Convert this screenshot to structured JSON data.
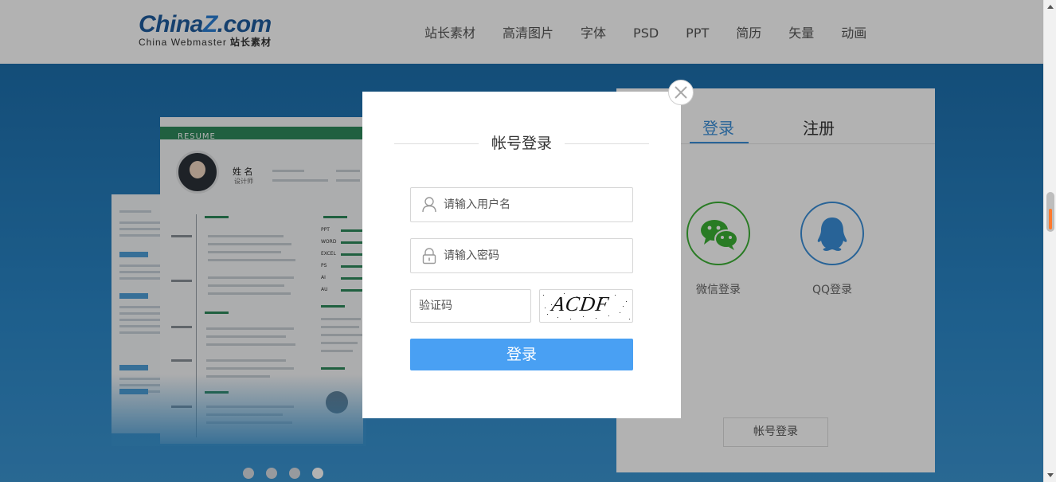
{
  "header": {
    "logo": {
      "main_left": "China",
      "main_z": "Z",
      "main_right": ".com",
      "sub_en": "China Webmaster",
      "sub_cn": "站长素材"
    },
    "nav": [
      "站长素材",
      "高清图片",
      "字体",
      "PSD",
      "PPT",
      "简历",
      "矢量",
      "动画"
    ]
  },
  "hero": {
    "resume": {
      "banner": "RESUME",
      "name": "姓 名",
      "title": "设计师"
    },
    "carousel": {
      "dot_count": 4,
      "active_index": 3
    }
  },
  "login_panel": {
    "tabs": {
      "login": "登录",
      "register": "注册"
    },
    "social": {
      "wechat_label": "微信登录",
      "qq_label": "QQ登录"
    },
    "account_login_button": "帐号登录"
  },
  "modal": {
    "title": "帐号登录",
    "username": {
      "placeholder": "请输入用户名",
      "value": ""
    },
    "password": {
      "placeholder": "请输入密码",
      "value": ""
    },
    "captcha": {
      "placeholder": "验证码",
      "value": "",
      "image_text": "ACDF"
    },
    "submit_label": "登录"
  },
  "colors": {
    "brand_blue": "#1f5c9e",
    "accent_blue": "#49a0f3",
    "tab_active": "#3a8fd8",
    "wechat_green": "#3cb034",
    "hero_bg": "#1c6fae",
    "resume_green": "#2e8a5c"
  },
  "icons": {
    "close": "close-icon",
    "user": "user-icon",
    "lock": "lock-icon",
    "wechat": "wechat-icon",
    "qq": "qq-icon"
  }
}
